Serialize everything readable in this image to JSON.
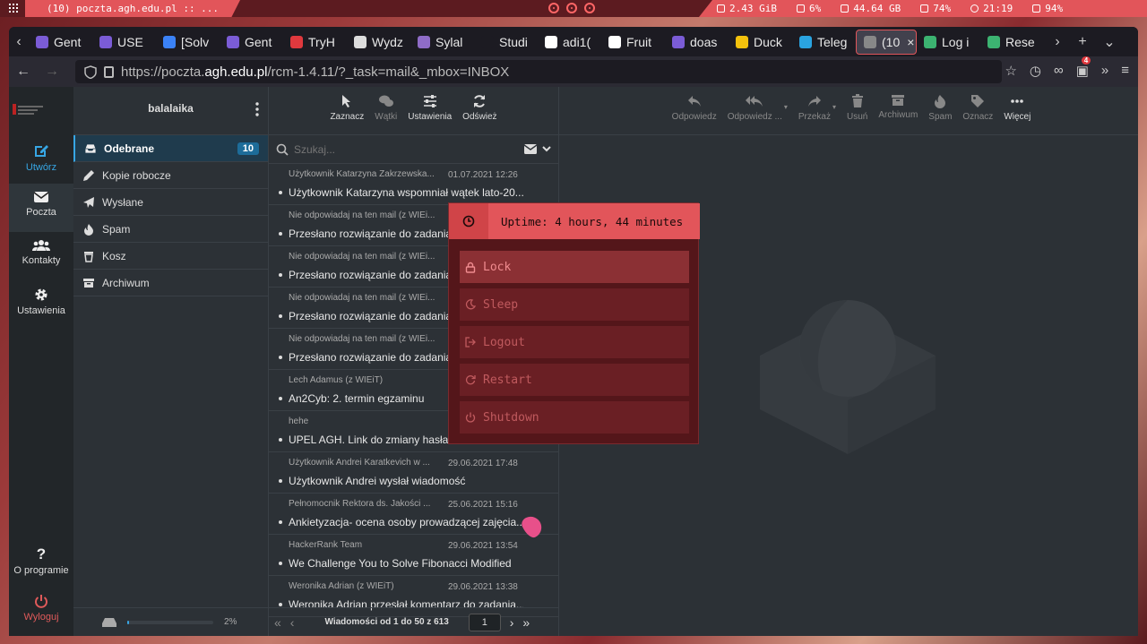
{
  "sysbar": {
    "window_title": "(10) poczta.agh.edu.pl :: ...",
    "stats": [
      {
        "icon": "memory-icon",
        "value": "2.43 GiB"
      },
      {
        "icon": "cpu-icon",
        "value": "6%"
      },
      {
        "icon": "disk-icon",
        "value": "44.64 GB"
      },
      {
        "icon": "volume-icon",
        "value": "74%"
      },
      {
        "icon": "clock-icon",
        "value": "21:19"
      },
      {
        "icon": "battery-icon",
        "value": "94%"
      }
    ]
  },
  "tabs": [
    {
      "label": "Gent",
      "color": "#7b5cd6"
    },
    {
      "label": "USE",
      "color": "#7b5cd6"
    },
    {
      "label": "[Solv",
      "color": "#3b82f6"
    },
    {
      "label": "Gent",
      "color": "#7b5cd6"
    },
    {
      "label": "TryH",
      "color": "#e0393e"
    },
    {
      "label": "Wydz",
      "color": "#dddddd"
    },
    {
      "label": "Sylal",
      "color": "#8f6cc7"
    },
    {
      "label": "Studi",
      "color": "#1c1b22"
    },
    {
      "label": "adi1(",
      "color": "#ffffff"
    },
    {
      "label": "Fruit",
      "color": "#ffffff"
    },
    {
      "label": "doas",
      "color": "#7b5cd6"
    },
    {
      "label": "Duck",
      "color": "#f4c20d"
    },
    {
      "label": "Teleg",
      "color": "#2aa3e0"
    },
    {
      "label": "(10",
      "color": "#888888",
      "active": true
    },
    {
      "label": "Log i",
      "color": "#3cb371"
    },
    {
      "label": "Rese",
      "color": "#3cb371"
    }
  ],
  "url": {
    "prefix": "https://poczta.",
    "domain": "agh.edu.pl",
    "path": "/rcm-1.4.11/?_task=mail&_mbox=INBOX",
    "badge": "4"
  },
  "nav": {
    "compose": "Utwórz",
    "mail": "Poczta",
    "contacts": "Kontakty",
    "settings": "Ustawienia",
    "about": "O programie",
    "logout": "Wyloguj"
  },
  "folders": {
    "header": "balalaika",
    "items": [
      {
        "label": "Odebrane",
        "count": "10",
        "icon": "inbox-icon"
      },
      {
        "label": "Kopie robocze",
        "icon": "pencil-icon"
      },
      {
        "label": "Wysłane",
        "icon": "paper-plane-icon"
      },
      {
        "label": "Spam",
        "icon": "fire-icon"
      },
      {
        "label": "Kosz",
        "icon": "trash-icon"
      },
      {
        "label": "Archiwum",
        "icon": "archive-icon"
      }
    ],
    "quota_percent": "2%",
    "quota_fraction": 0.02
  },
  "list_toolbar": {
    "select": "Zaznacz",
    "threads": "Wątki",
    "options": "Ustawienia",
    "refresh": "Odśwież"
  },
  "search": {
    "placeholder": "Szukaj..."
  },
  "messages": [
    {
      "from": "Użytkownik Katarzyna Zakrzewska...",
      "date": "01.07.2021 12:26",
      "subject": "Użytkownik Katarzyna wspomniał wątek lato-20..."
    },
    {
      "from": "Nie odpowiadaj na ten mail (z WIEi...",
      "date": "",
      "subject": "Przesłano rozwiązanie do zadania"
    },
    {
      "from": "Nie odpowiadaj na ten mail (z WIEi...",
      "date": "",
      "subject": "Przesłano rozwiązanie do zadania"
    },
    {
      "from": "Nie odpowiadaj na ten mail (z WIEi...",
      "date": "",
      "subject": "Przesłano rozwiązanie do zadania"
    },
    {
      "from": "Nie odpowiadaj na ten mail (z WIEi...",
      "date": "",
      "subject": "Przesłano rozwiązanie do zadania"
    },
    {
      "from": "Lech Adamus (z WIEiT)",
      "date": "",
      "subject": "An2Cyb: 2. termin egzaminu"
    },
    {
      "from": "hehe",
      "date": "",
      "subject": "UPEL AGH. Link do zmiany hasła."
    },
    {
      "from": "Użytkownik Andrei Karatkevich w ...",
      "date": "29.06.2021 17:48",
      "subject": "Użytkownik Andrei wysłał wiadomość"
    },
    {
      "from": "Pełnomocnik Rektora ds. Jakości ...",
      "date": "25.06.2021 15:16",
      "subject": "Ankietyzacja- ocena osoby prowadzącej zajęcia..."
    },
    {
      "from": "HackerRank Team",
      "date": "29.06.2021 13:54",
      "subject": "We Challenge You to Solve Fibonacci Modified"
    },
    {
      "from": "Weronika Adrian (z WIEiT)",
      "date": "29.06.2021 13:38",
      "subject": "Weronika Adrian przesłał komentarz do zadania..."
    }
  ],
  "list_footer": {
    "info": "Wiadomości od 1 do 50 z 613",
    "page": "1"
  },
  "content_toolbar": [
    {
      "label": "Odpowiedz",
      "icon": "reply-icon"
    },
    {
      "label": "Odpowiedz ...",
      "icon": "reply-all-icon"
    },
    {
      "label": "Przekaż",
      "icon": "forward-icon"
    },
    {
      "label": "Usuń",
      "icon": "trash-icon"
    },
    {
      "label": "Archiwum",
      "icon": "archive-icon"
    },
    {
      "label": "Spam",
      "icon": "fire-icon"
    },
    {
      "label": "Oznacz",
      "icon": "tag-icon"
    },
    {
      "label": "Więcej",
      "icon": "more-icon"
    }
  ],
  "dialog": {
    "uptime": "Uptime: 4 hours, 44 minutes",
    "options": [
      {
        "label": "Lock",
        "icon": "lock-icon"
      },
      {
        "label": "Sleep",
        "icon": "moon-icon"
      },
      {
        "label": "Logout",
        "icon": "logout-icon"
      },
      {
        "label": "Restart",
        "icon": "restart-icon"
      },
      {
        "label": "Shutdown",
        "icon": "power-icon"
      }
    ]
  },
  "colors": {
    "accent": "#37a6e4",
    "dialog_header": "#e2555a",
    "dialog_bg": "#54161a",
    "sysbar": "#e2555a"
  }
}
